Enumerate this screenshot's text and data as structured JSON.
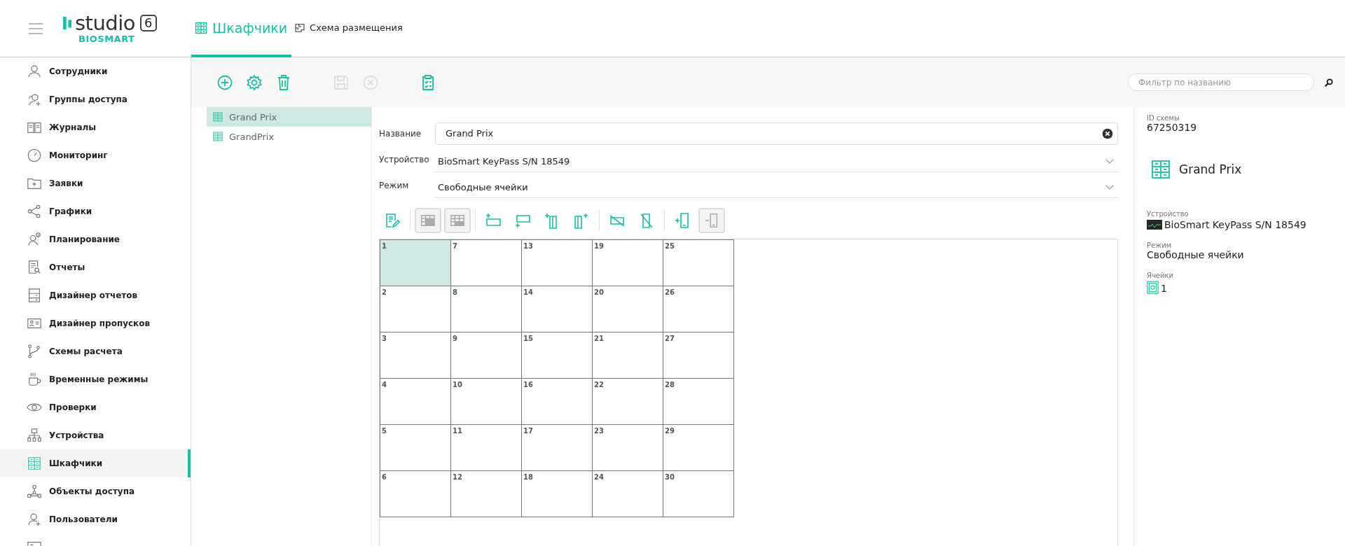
{
  "header": {
    "logo_word": "studio",
    "logo_version": "6",
    "logo_brand": "BIOSMART",
    "tabs": [
      {
        "label": "Шкафчики",
        "selected": true
      },
      {
        "label": "Схема размещения",
        "selected": false
      }
    ]
  },
  "sidebar": {
    "items": [
      {
        "label": "Сотрудники",
        "selected": false
      },
      {
        "label": "Группы доступа",
        "selected": false
      },
      {
        "label": "Журналы",
        "selected": false
      },
      {
        "label": "Мониторинг",
        "selected": false
      },
      {
        "label": "Заявки",
        "selected": false
      },
      {
        "label": "Графики",
        "selected": false
      },
      {
        "label": "Планирование",
        "selected": false
      },
      {
        "label": "Отчеты",
        "selected": false
      },
      {
        "label": "Дизайнер отчетов",
        "selected": false
      },
      {
        "label": "Дизайнер пропусков",
        "selected": false
      },
      {
        "label": "Схемы расчета",
        "selected": false
      },
      {
        "label": "Временные режимы",
        "selected": false
      },
      {
        "label": "Проверки",
        "selected": false
      },
      {
        "label": "Устройства",
        "selected": false
      },
      {
        "label": "Шкафчики",
        "selected": true
      },
      {
        "label": "Объекты доступа",
        "selected": false
      },
      {
        "label": "Пользователи",
        "selected": false
      }
    ]
  },
  "toolbar": [
    {
      "disabled": false
    },
    {
      "disabled": false
    },
    {
      "disabled": false
    },
    {
      "disabled": true
    },
    {
      "disabled": true
    },
    {
      "disabled": false
    }
  ],
  "search": {
    "placeholder": "Фильтр по названию"
  },
  "schemes": [
    {
      "label": "Grand Prix",
      "selected": true
    },
    {
      "label": "GrandPrix",
      "selected": false
    }
  ],
  "form": {
    "name_label": "Название",
    "name_value": "Grand Prix",
    "device_label": "Устройство",
    "device_value": "BioSmart KeyPass S/N 18549",
    "mode_label": "Режим",
    "mode_value": "Свободные ячейки"
  },
  "cell_tools": [
    [
      {
        "disabled": false
      }
    ],
    [
      {
        "disabled": true
      },
      {
        "disabled": true
      }
    ],
    [
      {
        "disabled": false
      },
      {
        "disabled": false
      },
      {
        "disabled": false
      },
      {
        "disabled": false
      }
    ],
    [
      {
        "disabled": false
      },
      {
        "disabled": false
      }
    ],
    [
      {
        "disabled": false
      },
      {
        "disabled": true
      }
    ]
  ],
  "grid": [
    [
      {
        "label": "1",
        "selected": true
      },
      {
        "label": "7",
        "selected": false
      },
      {
        "label": "13",
        "selected": false
      },
      {
        "label": "19",
        "selected": false
      },
      {
        "label": "25",
        "selected": false
      }
    ],
    [
      {
        "label": "2",
        "selected": false
      },
      {
        "label": "8",
        "selected": false
      },
      {
        "label": "14",
        "selected": false
      },
      {
        "label": "20",
        "selected": false
      },
      {
        "label": "26",
        "selected": false
      }
    ],
    [
      {
        "label": "3",
        "selected": false
      },
      {
        "label": "9",
        "selected": false
      },
      {
        "label": "15",
        "selected": false
      },
      {
        "label": "21",
        "selected": false
      },
      {
        "label": "27",
        "selected": false
      }
    ],
    [
      {
        "label": "4",
        "selected": false
      },
      {
        "label": "10",
        "selected": false
      },
      {
        "label": "16",
        "selected": false
      },
      {
        "label": "22",
        "selected": false
      },
      {
        "label": "28",
        "selected": false
      }
    ],
    [
      {
        "label": "5",
        "selected": false
      },
      {
        "label": "11",
        "selected": false
      },
      {
        "label": "17",
        "selected": false
      },
      {
        "label": "23",
        "selected": false
      },
      {
        "label": "29",
        "selected": false
      }
    ],
    [
      {
        "label": "6",
        "selected": false
      },
      {
        "label": "12",
        "selected": false
      },
      {
        "label": "18",
        "selected": false
      },
      {
        "label": "24",
        "selected": false
      },
      {
        "label": "30",
        "selected": false
      }
    ]
  ],
  "details": {
    "id_label": "ID схемы",
    "id_value": "67250319",
    "title": "Grand Prix",
    "device_label": "Устройство",
    "device_value": "BioSmart KeyPass S/N 18549",
    "mode_label": "Режим",
    "mode_value": "Свободные ячейки",
    "cells_label": "Ячейки",
    "cells_value": "1"
  }
}
